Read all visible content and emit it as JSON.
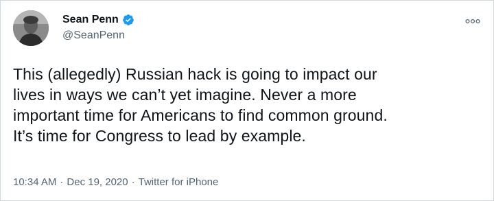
{
  "tweet": {
    "author": {
      "name": "Sean Penn",
      "handle": "@SeanPenn",
      "verified": true,
      "avatar_icon": "profile-photo"
    },
    "text": "This (allegedly) Russian hack is going to impact our\nlives in ways we can’t yet imagine. Never a more\nimportant time for Americans to find common ground.\nIt’s time for Congress to lead by example.",
    "time": "10:34 AM",
    "separator": "·",
    "date": "Dec 19, 2020",
    "source": "Twitter for iPhone"
  },
  "icons": {
    "verified": "verified-badge-icon",
    "more": "more-options-icon"
  },
  "colors": {
    "verified_blue": "#1d9bf0",
    "secondary_text": "#536471",
    "primary_text": "#0f1419",
    "border": "#cfd9de"
  }
}
